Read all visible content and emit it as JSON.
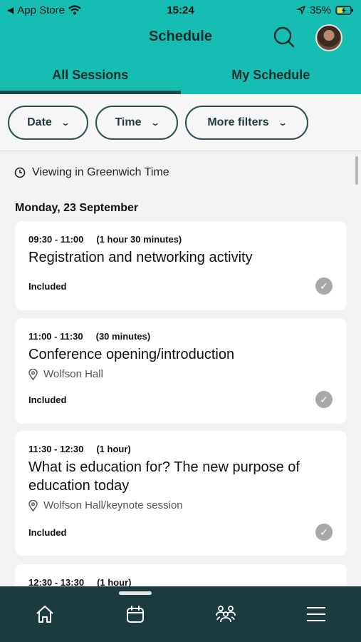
{
  "status_bar": {
    "back_app": "App Store",
    "time": "15:24",
    "battery": "35%"
  },
  "header": {
    "title": "Schedule"
  },
  "tabs": [
    {
      "label": "All Sessions",
      "active": true
    },
    {
      "label": "My Schedule",
      "active": false
    }
  ],
  "filters": [
    {
      "label": "Date"
    },
    {
      "label": "Time"
    },
    {
      "label": "More filters"
    }
  ],
  "viewing_note": "Viewing in Greenwich Time",
  "date_heading": "Monday, 23 September",
  "sessions": [
    {
      "time": "09:30 - 11:00",
      "duration": "(1 hour 30 minutes)",
      "title": "Registration and networking activity",
      "location": "",
      "status": "Included"
    },
    {
      "time": "11:00 - 11:30",
      "duration": "(30 minutes)",
      "title": "Conference opening/introduction",
      "location": "Wolfson Hall",
      "status": "Included"
    },
    {
      "time": "11:30 - 12:30",
      "duration": "(1 hour)",
      "title": "What is education for? The new purpose of education today",
      "location": "Wolfson Hall/keynote session",
      "status": "Included"
    },
    {
      "time": "12:30 - 13:30",
      "duration": "(1 hour)",
      "title": "",
      "location": "",
      "status": ""
    }
  ],
  "bottom_nav": [
    {
      "icon": "home-icon",
      "active": false
    },
    {
      "icon": "calendar-icon",
      "active": true
    },
    {
      "icon": "people-icon",
      "active": false
    },
    {
      "icon": "menu-icon",
      "active": false
    }
  ],
  "colors": {
    "accent": "#16bdb3",
    "nav_background": "#1b3b3f",
    "tab_indicator": "#1d4a4d"
  }
}
